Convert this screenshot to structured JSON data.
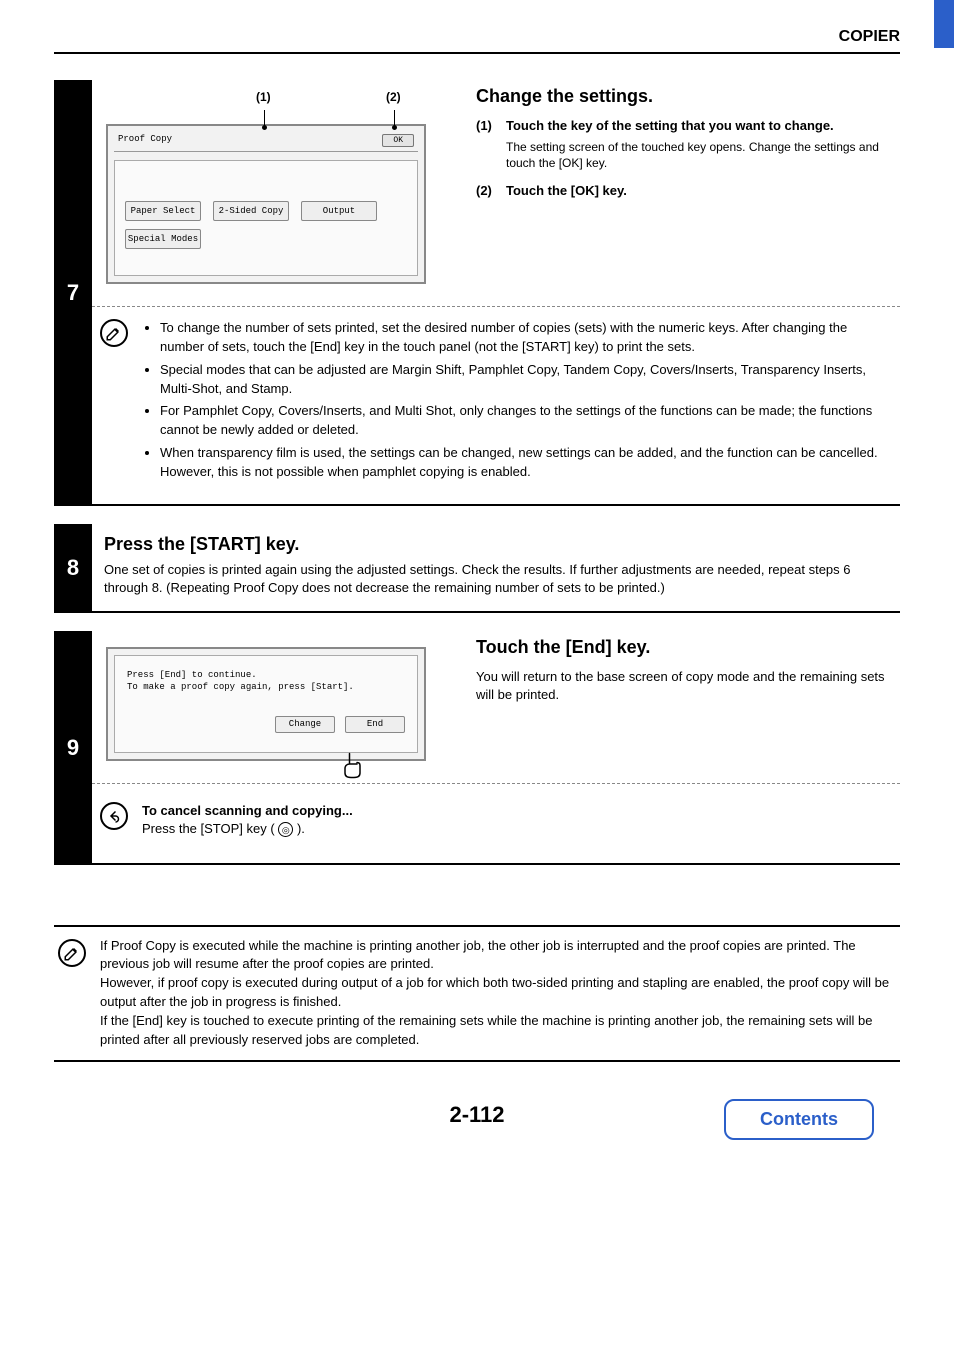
{
  "header": {
    "chapter": "COPIER"
  },
  "step7": {
    "number": "7",
    "callout1": "(1)",
    "callout2": "(2)",
    "screen": {
      "title": "Proof Copy",
      "ok": "OK",
      "paperSelect": "Paper Select",
      "twoSided": "2-Sided Copy",
      "output": "Output",
      "specialModes": "Special Modes"
    },
    "heading": "Change the settings.",
    "items": [
      {
        "num": "(1)",
        "main": "Touch the key of the setting that you want to change.",
        "sub": "The setting screen of the touched key opens. Change the settings and touch the [OK] key."
      },
      {
        "num": "(2)",
        "main": "Touch the [OK] key.",
        "sub": ""
      }
    ],
    "bullets": [
      "To change the number of sets printed, set the desired number of copies (sets) with the numeric keys. After changing the number of sets, touch the [End] key in the touch panel (not the [START] key) to print the sets.",
      "Special modes that can be adjusted are Margin Shift, Pamphlet Copy, Tandem Copy, Covers/Inserts, Transparency Inserts, Multi-Shot, and Stamp.",
      "For Pamphlet Copy, Covers/Inserts, and Multi Shot, only changes to the settings of the functions can be made; the functions cannot be newly added or deleted.",
      "When transparency film is used, the settings can be changed, new settings can be added, and the function can be cancelled. However, this is not possible when pamphlet copying is enabled."
    ]
  },
  "step8": {
    "number": "8",
    "heading": "Press the [START] key.",
    "body": "One set of copies is printed again using the adjusted settings. Check the results. If further adjustments are needed, repeat steps 6 through 8. (Repeating Proof Copy does not decrease the remaining number of sets to be printed.)"
  },
  "step9": {
    "number": "9",
    "screen": {
      "line1": "Press [End] to continue.",
      "line2": "To make a proof copy again, press [Start].",
      "change": "Change",
      "end": "End"
    },
    "heading": "Touch the [End] key.",
    "body": "You will return to the base screen of copy mode and the remaining sets will be printed.",
    "cancelTitle": "To cancel scanning and copying...",
    "cancelBodyPre": "Press the [STOP] key (",
    "cancelBodyPost": ")."
  },
  "finalNote": {
    "p1": "If Proof Copy is executed while the machine is printing another job, the other job is interrupted and the proof copies are printed. The previous job will resume after the proof copies are printed.",
    "p2": "However, if proof copy is executed during output of a job for which both two-sided printing and stapling are enabled, the proof copy will be output after the job in progress is finished.",
    "p3": "If the [End] key is touched to execute printing of the remaining sets while the machine is printing another job, the remaining sets will be printed after all previously reserved jobs are completed."
  },
  "pageNum": "2-112",
  "contents": "Contents"
}
